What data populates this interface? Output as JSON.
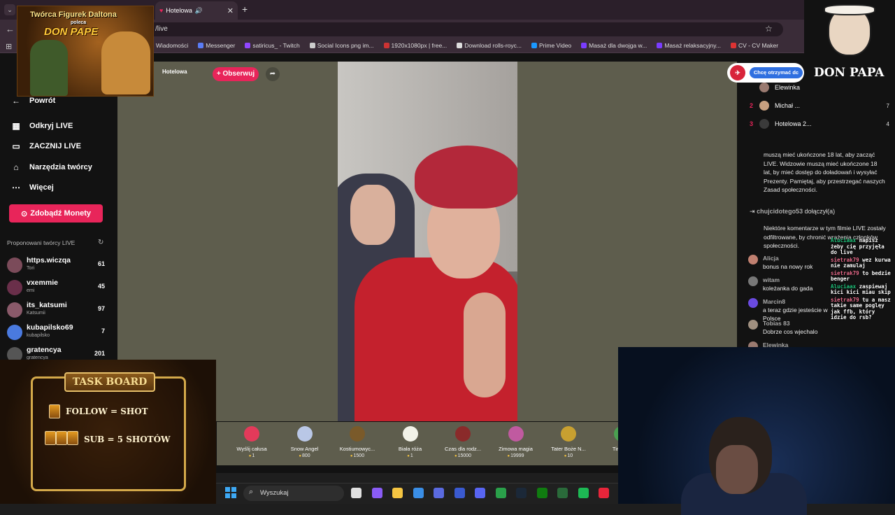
{
  "browser": {
    "tab_title": "Hotelowa",
    "new_tab": "+",
    "url": "/live",
    "bookmarks": [
      "Wiadomości",
      "Messenger",
      "satiricus_ - Twitch",
      "Social Icons png im...",
      "1920x1080px | free...",
      "Download rolls-royc...",
      "Prime Video",
      "Masaż dla dwojga w...",
      "Masaż relaksacyjny...",
      "CV - CV Maker"
    ],
    "bookmark_colors": [
      "#3d6fe0",
      "#5a7cf5",
      "#9146ff",
      "#cccccc",
      "#c33",
      "#ddd",
      "#1a98ff",
      "#7a3cff",
      "#7a3cff",
      "#d33"
    ]
  },
  "sidebar": {
    "back": "Powrót",
    "items": [
      {
        "label": "Odkryj LIVE",
        "icon": "calendar-icon"
      },
      {
        "label": "ZACZNIJ LIVE",
        "icon": "camera-icon"
      },
      {
        "label": "Narzędzia twórcy",
        "icon": "lightbulb-icon"
      },
      {
        "label": "Więcej",
        "icon": "more-icon"
      }
    ],
    "coins_button": "Zdobądź Monety",
    "suggested_title": "Proponowani twórcy LIVE",
    "creators": [
      {
        "name": "https.wiczqa",
        "sub": "Tori",
        "count": "61",
        "color": "#7b4b5a"
      },
      {
        "name": "vxemmie",
        "sub": "emi",
        "count": "45",
        "color": "#6a2f4a"
      },
      {
        "name": "its_katsumi",
        "sub": "Katsumii",
        "count": "97",
        "color": "#8a5a6a"
      },
      {
        "name": "kubapilsko69",
        "sub": "kubapilsko",
        "count": "7",
        "color": "#4a7adf"
      },
      {
        "name": "gratencya",
        "sub": "gratencya",
        "count": "201",
        "color": "#555"
      }
    ]
  },
  "stream": {
    "host": "Hotelowa",
    "follow": "+ Obserwuj",
    "share": "➦"
  },
  "gifts": [
    {
      "name": "Wyślij całusa",
      "price": "1",
      "color": "#e33a5a"
    },
    {
      "name": "Snow Angel",
      "price": "800",
      "color": "#b9c7e6"
    },
    {
      "name": "Kostiumowyc...",
      "price": "1500",
      "color": "#7a5a2a"
    },
    {
      "name": "Biała róża",
      "price": "1",
      "color": "#f2f2e8"
    },
    {
      "name": "Czas dla rodz...",
      "price": "15000",
      "color": "#8a2a2a"
    },
    {
      "name": "Zimowa magia",
      "price": "19999",
      "color": "#c05aa0"
    },
    {
      "name": "Tater Boże N...",
      "price": "10",
      "color": "#c8a030"
    },
    {
      "name": "Tiny Bo",
      "price": "",
      "color": "#4aa050"
    }
  ],
  "chat": {
    "get_button": "Chcę otrzymać dc",
    "ranking": [
      {
        "rank": "",
        "name": "Elewinka",
        "value": "",
        "color": "#9a7a70"
      },
      {
        "rank": "2",
        "name": "Michał ...",
        "value": "7",
        "color": "#c8a080"
      },
      {
        "rank": "3",
        "name": "Hotelowa 2...",
        "value": "4",
        "color": "#3a3a3a"
      }
    ],
    "notice1": "muszą mieć ukończone 18 lat, aby zacząć LIVE. Widzowie muszą mieć ukończone 18 lat, by mieć dostęp do doładowań i wysyłać Prezenty. Pamiętaj, aby przestrzegać naszych Zasad społeczności.",
    "joined_user": "chujcidotego53",
    "joined_text": "dołączył(a)",
    "notice2": "Niektóre komentarze w tym filmie LIVE zostały odfiltrowane, by chronić wrażenia członków społeczności.",
    "messages": [
      {
        "user": "Alicja",
        "text": "bonus na nowy rok",
        "color": "#c08070"
      },
      {
        "user": "witam",
        "text": "koleżanka do gada",
        "color": "#777"
      },
      {
        "user": "Marcin8",
        "text": "a teraz gdzie jesteście w Polsce",
        "color": "#6a4ae0"
      },
      {
        "user": "Tobias 83",
        "text": "Dobrze cos wjechalo",
        "color": "#a09080"
      },
      {
        "user": "Elewinka",
        "text": "",
        "color": "#9a7a70"
      }
    ],
    "overlay_lines": [
      {
        "u": "Aluciaax",
        "t": "napisz żeby cię przyjęła do live"
      },
      {
        "u": "sietrak79",
        "t": "wez kurwa nie zamulaj"
      },
      {
        "u": "sietrak79",
        "t": "to bedzie benger"
      },
      {
        "u": "Aluciaax",
        "t": "zaspiewaj kici kici miau skip"
      },
      {
        "u": "sietrak79",
        "t": "tu a masz takie same poglęy jak ffb, który idzie do rsb?"
      }
    ]
  },
  "overlays": {
    "daltona_line1": "Twórca Figurek Daltona",
    "daltona_line2": "poleca",
    "daltona_brand": "DON PAPE",
    "logo_text": "DON PAPA",
    "taskboard_title": "TASK BOARD",
    "task1": "FOLLOW = SHOT",
    "task2": "SUB = 5 SHOTÓW"
  },
  "taskbar": {
    "search": "Wyszukaj",
    "icons": [
      "#e0e0e0",
      "#8a5cf6",
      "#f5c542",
      "#3a8ee6",
      "#5a6ae0",
      "#3a5ad0",
      "#5865f2",
      "#2aa04a",
      "#1b2838",
      "#107c10",
      "#2a6a3a",
      "#1db954",
      "#e8253a"
    ]
  }
}
